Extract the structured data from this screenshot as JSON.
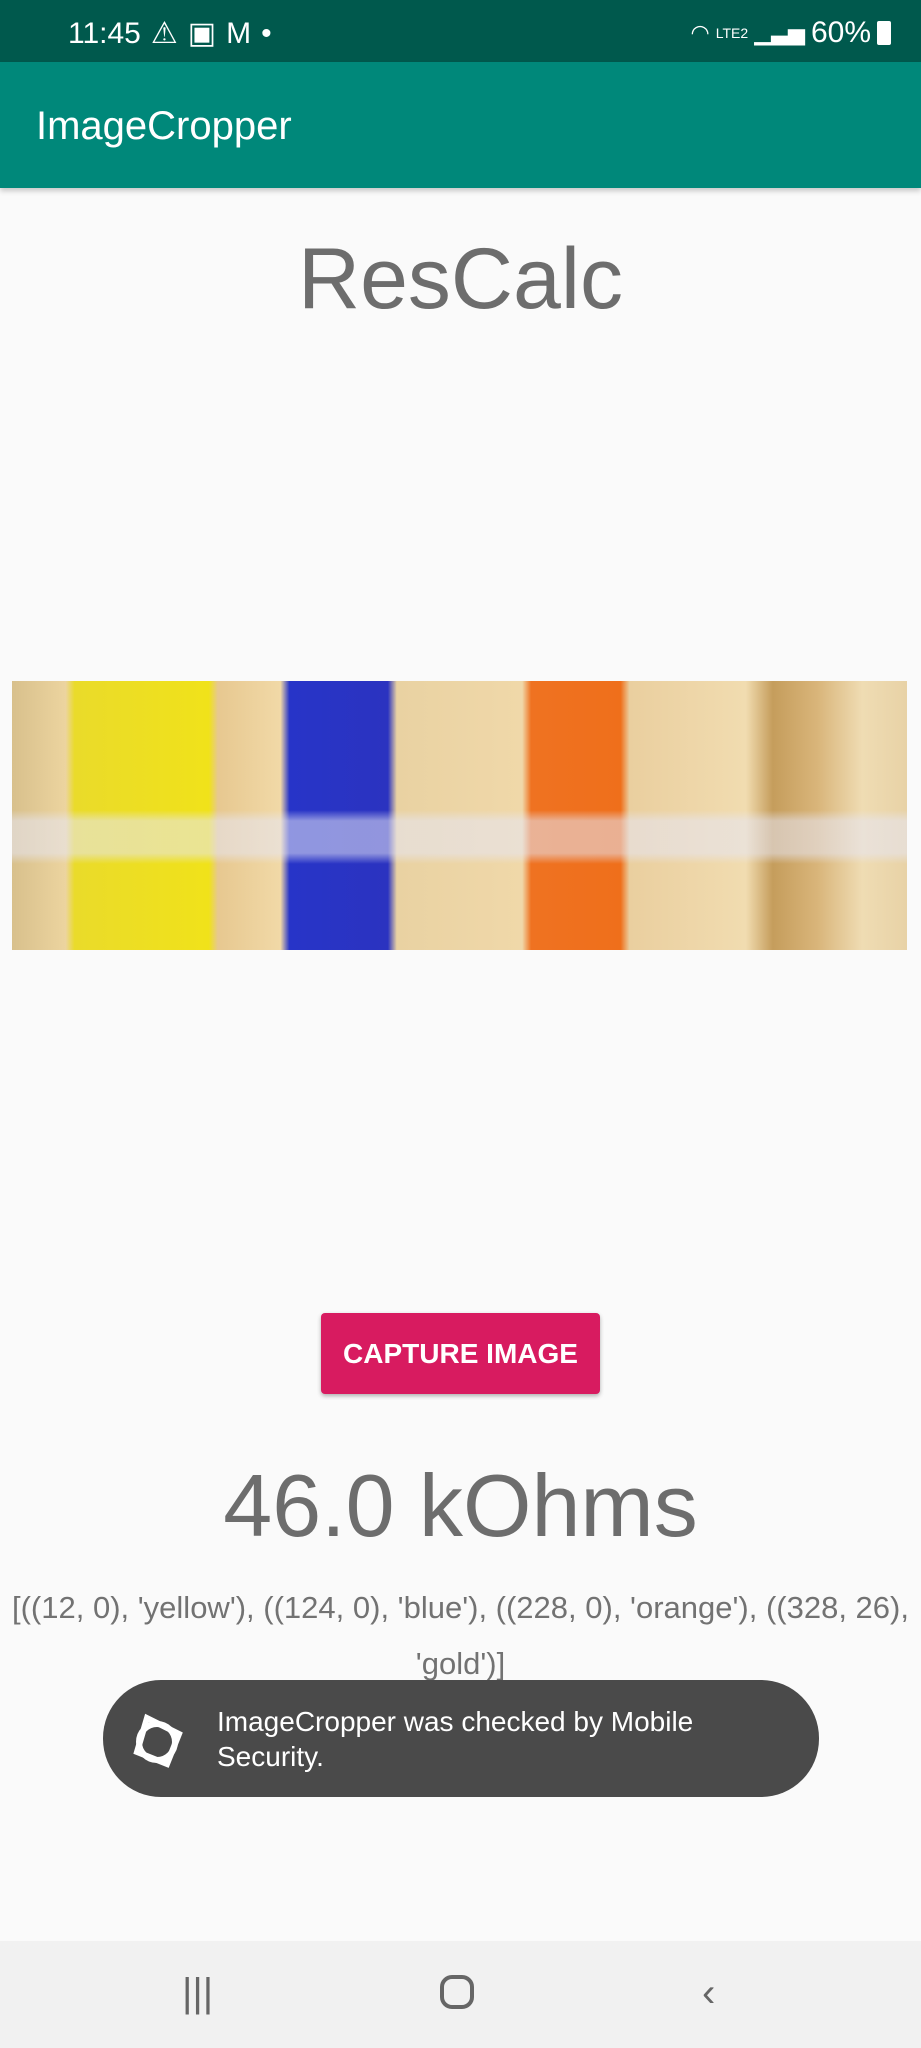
{
  "status_bar": {
    "time": "11:45",
    "battery": "60%",
    "network": "LTE2"
  },
  "app_bar": {
    "title": "ImageCropper"
  },
  "main": {
    "title": "ResCalc",
    "capture_label": "CAPTURE IMAGE",
    "result": "46.0 kOhms",
    "bands_text": "[((12, 0), 'yellow'), ((124, 0), 'blue'), ((228, 0), 'orange'), ((328, 26), 'gold')]",
    "colors": {
      "accent": "#D81B60",
      "appbar": "#00887A",
      "statusbar": "#00594D"
    }
  },
  "toast": {
    "message": "ImageCropper was checked by Mobile Security."
  },
  "nav": {
    "recents": "recents-icon",
    "home": "home-icon",
    "back": "back-icon"
  }
}
